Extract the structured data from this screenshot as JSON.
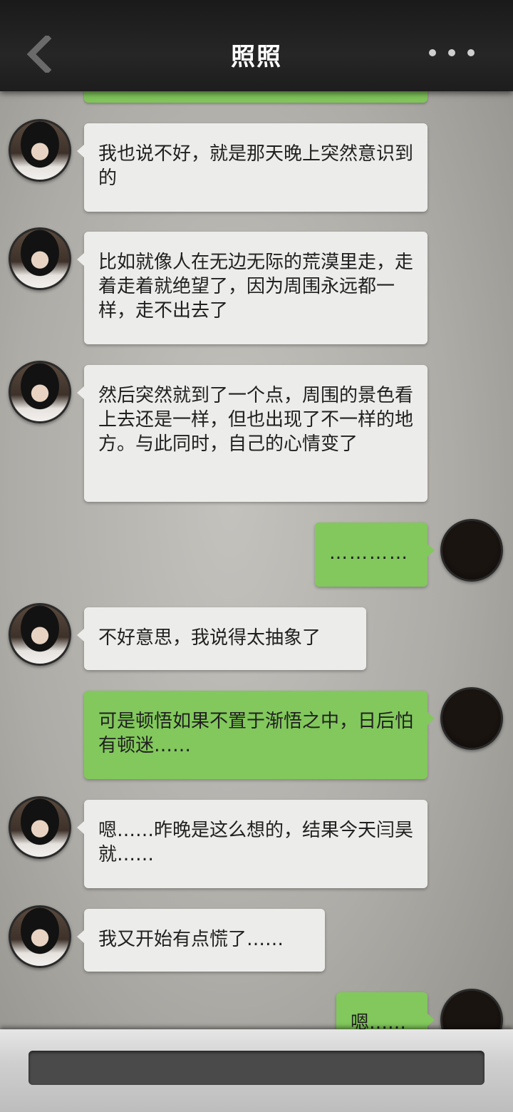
{
  "header": {
    "title": "照照"
  },
  "messages": [
    {
      "side": "left",
      "text": "我也说不好，就是那天晚上突然意识到的"
    },
    {
      "side": "left",
      "text": "比如就像人在无边无际的荒漠里走，走着走着就绝望了，因为周围永远都一样，走不出去了"
    },
    {
      "side": "left",
      "text": "然后突然就到了一个点，周围的景色看上去还是一样，但也出现了不一样的地方。与此同时，自己的心情变了"
    },
    {
      "side": "right",
      "text": "…………"
    },
    {
      "side": "left",
      "text": "不好意思，我说得太抽象了"
    },
    {
      "side": "right",
      "text": "可是顿悟如果不置于渐悟之中，日后怕有顿迷……"
    },
    {
      "side": "left",
      "text": "嗯……昨晚是这么想的，结果今天闫昊就……"
    },
    {
      "side": "left",
      "text": "我又开始有点慌了……"
    },
    {
      "side": "right",
      "text": "嗯……"
    }
  ],
  "icons": {
    "back": "chevron-left-icon",
    "more": "more-dots-icon"
  },
  "colors": {
    "incoming_bubble": "#ececea",
    "outgoing_bubble": "#82c85c",
    "header_bg": "#1e1e1e"
  }
}
